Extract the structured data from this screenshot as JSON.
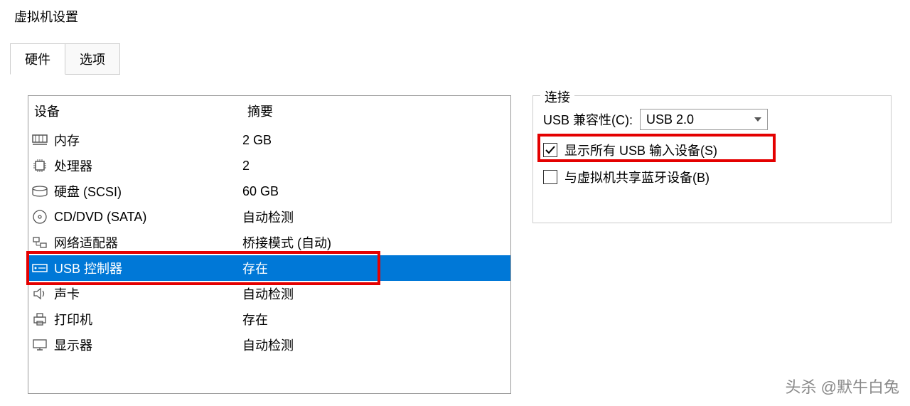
{
  "window": {
    "title": "虚拟机设置"
  },
  "tabs": {
    "hardware": "硬件",
    "options": "选项"
  },
  "deviceTable": {
    "header": {
      "device": "设备",
      "summary": "摘要"
    },
    "rows": [
      {
        "icon": "memory-icon",
        "label": "内存",
        "summary": "2 GB"
      },
      {
        "icon": "cpu-icon",
        "label": "处理器",
        "summary": "2"
      },
      {
        "icon": "disk-icon",
        "label": "硬盘 (SCSI)",
        "summary": "60 GB"
      },
      {
        "icon": "cd-icon",
        "label": "CD/DVD (SATA)",
        "summary": "自动检测"
      },
      {
        "icon": "network-icon",
        "label": "网络适配器",
        "summary": "桥接模式 (自动)"
      },
      {
        "icon": "usb-icon",
        "label": "USB 控制器",
        "summary": "存在"
      },
      {
        "icon": "sound-icon",
        "label": "声卡",
        "summary": "自动检测"
      },
      {
        "icon": "printer-icon",
        "label": "打印机",
        "summary": "存在"
      },
      {
        "icon": "display-icon",
        "label": "显示器",
        "summary": "自动检测"
      }
    ]
  },
  "connection": {
    "group": "连接",
    "compatLabel": "USB 兼容性(C):",
    "compatValue": "USB 2.0",
    "showAllInput": "显示所有 USB 输入设备(S)",
    "showAllInputChecked": true,
    "shareBluetooth": "与虚拟机共享蓝牙设备(B)",
    "shareBluetoothChecked": false
  },
  "watermark": "头杀 @默牛白兔"
}
